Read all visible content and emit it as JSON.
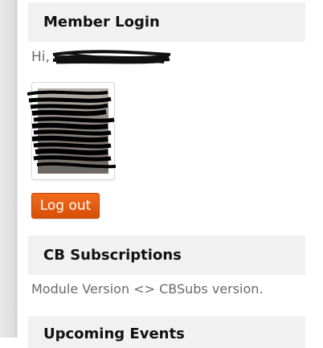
{
  "login_module": {
    "title": "Member Login",
    "greeting": "Hi,",
    "logout_label": "Log out"
  },
  "cbsubs_module": {
    "title": "CB Subscriptions",
    "text": "Module Version <> CBSubs version."
  },
  "events_module": {
    "title": "Upcoming Events"
  },
  "colors": {
    "accent_button": "#e05a0f",
    "header_bg": "#f1f1f1"
  }
}
